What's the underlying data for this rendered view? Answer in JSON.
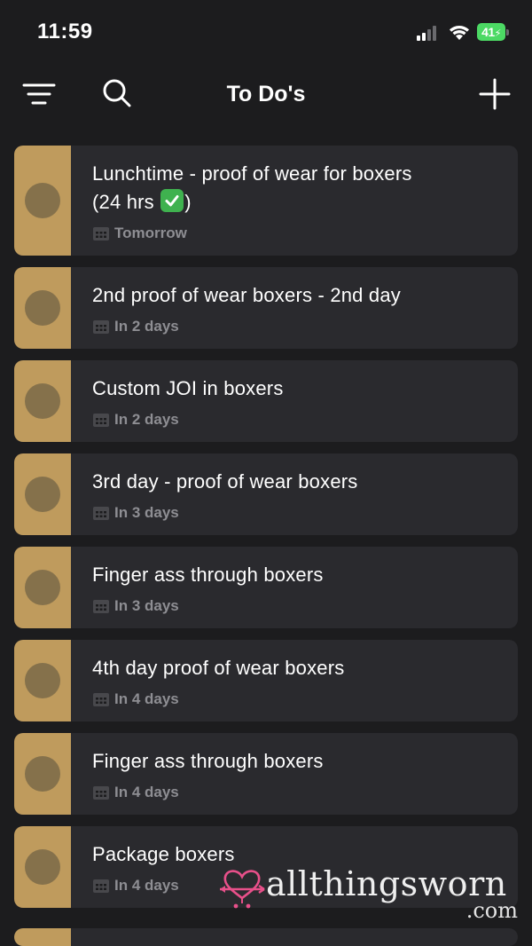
{
  "status_bar": {
    "time": "11:59",
    "battery": "41"
  },
  "header": {
    "title": "To Do's",
    "icons": {
      "menu": "filter-menu-icon",
      "search": "search-icon",
      "add": "plus-icon"
    }
  },
  "colors": {
    "background": "#1c1c1e",
    "card": "#2a2a2e",
    "accent": "#bf9b5d",
    "circle": "#85714b",
    "due_text": "#8e8e93",
    "battery": "#4cd964"
  },
  "tasks": [
    {
      "title": "Lunchtime - proof of wear for boxers",
      "title_line2": "(24 hrs",
      "title_line2_end": ")",
      "due": "Tomorrow"
    },
    {
      "title": "2nd proof of wear boxers - 2nd day",
      "due": "In 2 days"
    },
    {
      "title": "Custom JOI in boxers",
      "due": "In 2 days"
    },
    {
      "title": "3rd day - proof of wear boxers",
      "due": "In 3 days"
    },
    {
      "title": "Finger ass through boxers",
      "due": "In 3 days"
    },
    {
      "title": "4th day proof of wear boxers",
      "due": "In 4 days"
    },
    {
      "title": "Finger ass through boxers",
      "due": "In 4 days"
    },
    {
      "title": "Package boxers",
      "due": "In 4 days"
    }
  ],
  "watermark": {
    "text": "allthingsworn",
    "suffix": ".com"
  }
}
